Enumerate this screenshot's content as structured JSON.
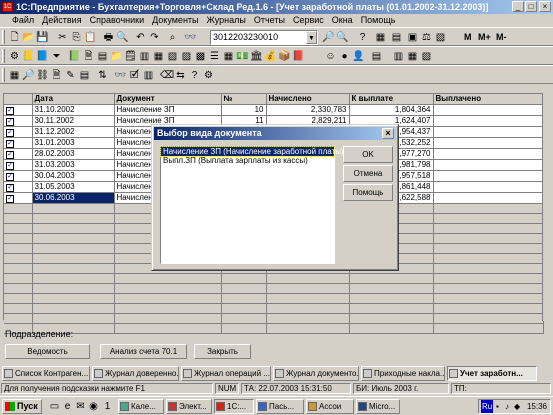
{
  "window": {
    "title": "1С:Предприятие - Бухгалтерия+Торговля+Склад Ред.1.6 - [Учет заработной платы (01.01.2002-31.12.2003)]",
    "app_icon": "1C",
    "controls": [
      "_",
      "□",
      "×"
    ]
  },
  "menu": [
    "Файл",
    "Действия",
    "Справочники",
    "Документы",
    "Журналы",
    "Отчеты",
    "Сервис",
    "Окна",
    "Помощь"
  ],
  "toolbar": {
    "combo_value": "3012203230010",
    "m_buttons": [
      "M",
      "M+",
      "M-"
    ]
  },
  "grid": {
    "columns": [
      "",
      "Дата",
      "Документ",
      "№",
      "Начислено",
      "К выплате",
      "Выплачено"
    ],
    "rows": [
      {
        "date": "31.10.2002",
        "doc": "Начисление ЗП",
        "num": "10",
        "accrued": "2,330,783",
        "payable": "1,804,364",
        "paid": ""
      },
      {
        "date": "30.11.2002",
        "doc": "Начисление ЗП",
        "num": "11",
        "accrued": "2,829,211",
        "payable": "1,624,407",
        "paid": ""
      },
      {
        "date": "31.12.2002",
        "doc": "Начисление ЗП",
        "num": "",
        "accrued": "",
        "payable": "1,954,437",
        "paid": ""
      },
      {
        "date": "31.01.2003",
        "doc": "Начисление ЗП",
        "num": "",
        "accrued": "",
        "payable": "2,532,252",
        "paid": ""
      },
      {
        "date": "28.02.2003",
        "doc": "Начисление ЗП",
        "num": "",
        "accrued": "",
        "payable": "1,977,270",
        "paid": ""
      },
      {
        "date": "31.03.2003",
        "doc": "Начисление ЗП",
        "num": "",
        "accrued": "",
        "payable": "1,981,798",
        "paid": ""
      },
      {
        "date": "30.04.2003",
        "doc": "Начисление ЗП",
        "num": "",
        "accrued": "",
        "payable": "1,957,518",
        "paid": ""
      },
      {
        "date": "31.05.2003",
        "doc": "Начисление ЗП",
        "num": "",
        "accrued": "",
        "payable": "1,861,448",
        "paid": ""
      },
      {
        "date": "30.06.2003",
        "doc": "Начисление ЗП",
        "num": "",
        "accrued": "",
        "payable": "1,622,588",
        "paid": ""
      }
    ],
    "empty_rows": 13
  },
  "bottom": {
    "dept_label": "Подразделение:",
    "buttons": [
      "Ведомость",
      "Анализ счета 70.1",
      "Закрыть"
    ]
  },
  "window_tabs": [
    {
      "label": "Список Контраген...",
      "active": false
    },
    {
      "label": "Журнал доверенно...",
      "active": false
    },
    {
      "label": "Журнал операций ...",
      "active": false
    },
    {
      "label": "Журнал документо...",
      "active": false
    },
    {
      "label": "Приходные накла...",
      "active": false
    },
    {
      "label": "Учет заработн...",
      "active": true
    }
  ],
  "status": {
    "hint": "Для получения подсказки нажмите F1",
    "num": "NUM",
    "ta": "ТА: 22.07.2003  15:31:50",
    "bi": "БИ: Июль 2003 г.",
    "tp": "ТП:"
  },
  "taskbar": {
    "start": "Пуск",
    "tasks": [
      "Кале...",
      "Элект...",
      "1С:...",
      "Пась...",
      "Accoи",
      "Micro..."
    ],
    "tray_lang": "Ru",
    "clock": "15:36"
  },
  "dialog": {
    "title": "Выбор вида документа",
    "items": [
      {
        "label": "Начисление ЗП (Начисление заработной платы)",
        "selected": true
      },
      {
        "label": "Выпл.ЗП (Выплата зарплаты из кассы)",
        "selected": false
      }
    ],
    "buttons": {
      "ok": "OK",
      "cancel": "Отмена",
      "help": "Помощь"
    }
  }
}
